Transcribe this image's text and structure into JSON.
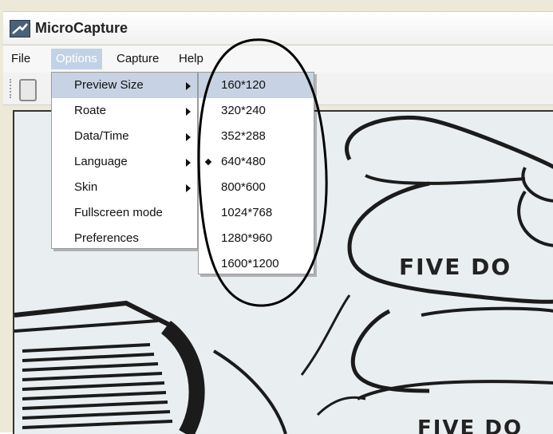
{
  "window": {
    "title": "MicroCapture",
    "app_icon": "microscope-icon"
  },
  "menubar": {
    "items": [
      {
        "label": "File"
      },
      {
        "label": "Options",
        "active": true
      },
      {
        "label": "Capture"
      },
      {
        "label": "Help"
      }
    ]
  },
  "options_menu": {
    "items": [
      {
        "label": "Preview Size",
        "submenu": true,
        "highlighted": true
      },
      {
        "label": "Roate",
        "submenu": true
      },
      {
        "label": "Data/Time",
        "submenu": true
      },
      {
        "label": "Language",
        "submenu": true
      },
      {
        "label": "Skin",
        "submenu": true
      },
      {
        "label": "Fullscreen mode",
        "submenu": false
      },
      {
        "label": "Preferences",
        "submenu": false
      }
    ]
  },
  "preview_size_menu": {
    "items": [
      {
        "label": "160*120",
        "highlighted": true
      },
      {
        "label": "320*240"
      },
      {
        "label": "352*288"
      },
      {
        "label": "640*480",
        "selected": true
      },
      {
        "label": "800*600"
      },
      {
        "label": "1024*768"
      },
      {
        "label": "1280*960"
      },
      {
        "label": "1600*1200"
      }
    ]
  },
  "preview": {
    "text_upper": "FIVE DO",
    "text_lower": "FIVE DO"
  }
}
